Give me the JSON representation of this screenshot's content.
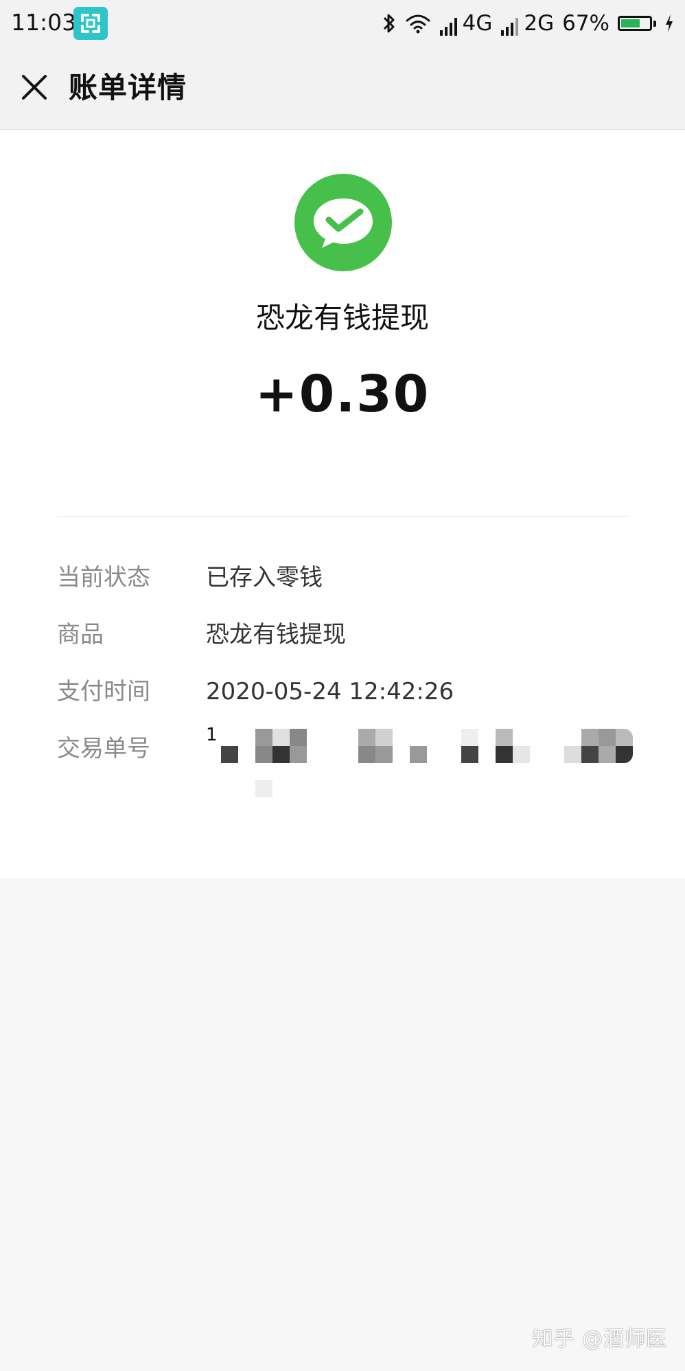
{
  "status_bar": {
    "time": "11:03",
    "network_1": "4G",
    "network_2": "2G",
    "battery_text": "67%",
    "battery_level": 0.67,
    "icons": [
      "screen-capture-icon",
      "bluetooth-icon",
      "wifi-icon",
      "signal-icon",
      "battery-icon",
      "charging-icon"
    ]
  },
  "nav": {
    "title": "账单详情",
    "close_icon": "close-icon"
  },
  "bill": {
    "merchant_logo_icon": "wechat-pay-icon",
    "merchant_name": "恐龙有钱提现",
    "amount": "+0.30"
  },
  "details": {
    "status_label": "当前状态",
    "status_value": "已存入零钱",
    "item_label": "商品",
    "item_value": "恐龙有钱提现",
    "time_label": "支付时间",
    "time_value": "2020-05-24 12:42:26",
    "order_label": "交易单号",
    "order_value_visible": "1"
  },
  "watermark": {
    "text": "知乎 @酒师医"
  },
  "colors": {
    "wechat_green": "#46c04a",
    "screen_icon": "#2ec5c9",
    "battery_fill": "#29b35b",
    "label_gray": "#8a8a8a"
  }
}
